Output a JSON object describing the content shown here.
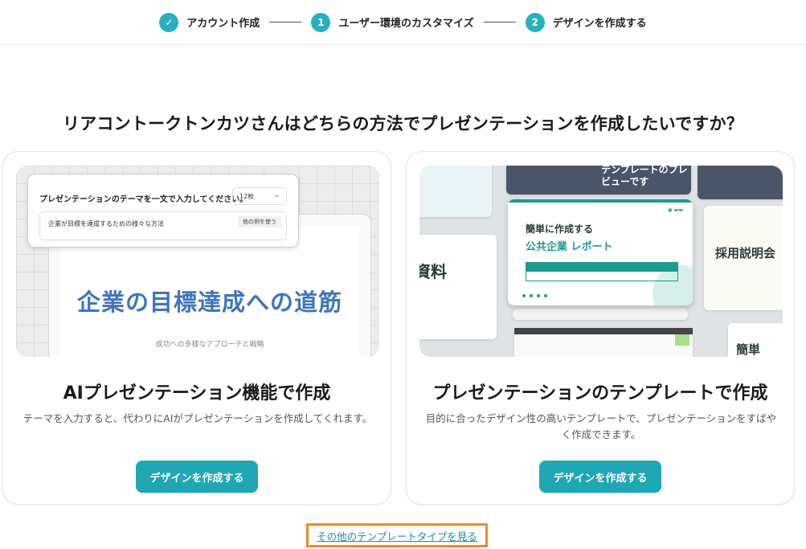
{
  "stepper": {
    "steps": [
      {
        "marker": "✓",
        "label": "アカウント作成"
      },
      {
        "marker": "1",
        "label": "ユーザー環境のカスタマイズ"
      },
      {
        "marker": "2",
        "label": "デザインを作成する"
      }
    ]
  },
  "question": "リアコントークトンカツさんはどちらの方法でプレゼンテーションを作成したいですか？",
  "cards": {
    "ai": {
      "title": "AIプレゼンテーション機能で作成",
      "description": "テーマを入力すると、代わりにAIがプレゼンテーションを作成してくれます。",
      "button": "デザインを作成する",
      "illustration": {
        "prompt_question": "プレゼンテーションのテーマを一文で入力してください。",
        "count_select": "12枚",
        "prompt_value": "企業が目標を達成するための様々な方法",
        "example_button": "他の例を使う",
        "slide_title": "企業の目標達成への道筋",
        "slide_subtitle": "成功への多様なアプローチと戦略"
      }
    },
    "template": {
      "title": "プレゼンテーションのテンプレートで作成",
      "description": "目的に合ったデザイン性の高いテンプレートで、プレゼンテーションをすばやく作成できます。",
      "button": "デザインを作成する",
      "illustration": {
        "preview_label": "テンプレートのプレビューです",
        "main_line1": "簡単に作成する",
        "main_line2": "公共企業 レポート",
        "recruit": "採用説明会",
        "material": "資料",
        "easy": "簡単"
      }
    }
  },
  "footer_link": "その他のテンプレートタイプを見る",
  "colors": {
    "accent": "#1fa7b6",
    "highlight_border": "#f08a24"
  }
}
